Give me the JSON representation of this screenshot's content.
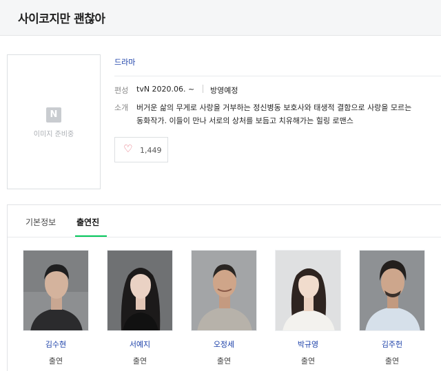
{
  "header": {
    "title": "사이코지만 괜찮아"
  },
  "poster": {
    "logo_letter": "N",
    "placeholder_text": "이미지 준비중"
  },
  "info": {
    "genre": "드라마",
    "broadcast_label": "편성",
    "broadcast_value": "tvN 2020.06. ~",
    "status": "방영예정",
    "summary_label": "소개",
    "summary_line1": "버거운 삶의 무게로 사랑을 거부하는 정신병동 보호사와 태생적 결함으로 사랑을 모르는",
    "summary_line2": "동화작가. 이들이 만나 서로의 상처를 보듬고 치유해가는 힐링 로맨스"
  },
  "like": {
    "icon": "heart-outline-icon",
    "count": "1,449"
  },
  "tabs": [
    {
      "label": "기본정보",
      "active": false
    },
    {
      "label": "출연진",
      "active": true
    }
  ],
  "cast": [
    {
      "name": "김수현",
      "role": "출연"
    },
    {
      "name": "서예지",
      "role": "출연"
    },
    {
      "name": "오정세",
      "role": "출연"
    },
    {
      "name": "박규영",
      "role": "출연"
    },
    {
      "name": "김주헌",
      "role": "출연"
    }
  ],
  "colors": {
    "link": "#1a3fa8",
    "accent": "#03c75a",
    "heart": "#e05a6a"
  }
}
